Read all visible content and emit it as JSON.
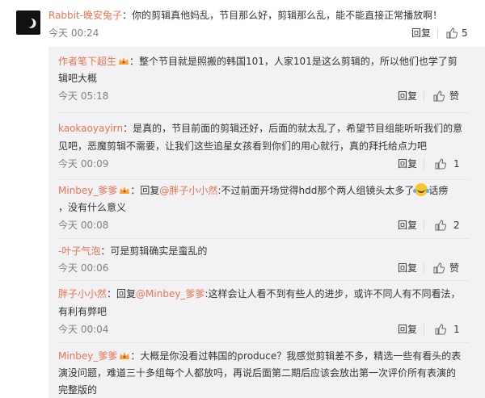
{
  "top": {
    "author": "Rabbit-晚安兔子",
    "sep": "：",
    "text": "你的剪辑真他妈乱，节目那么好，剪辑那么乱，能不能直接正常播放啊！",
    "time": "今天 00:24",
    "reply": "回复",
    "likes": "5"
  },
  "replies": [
    {
      "author": "作者笔下超生",
      "text1": "：整个节目就是照搬的韩国101，人家101是这么剪辑的，所以他们也学了剪",
      "text2": "辑吧大概",
      "time": "今天 05:18",
      "reply": "回复",
      "like": "赞"
    },
    {
      "author": "kaokaoyayirn",
      "text1": "：是真的，节目前面的剪辑还好，后面的就太乱了，希望节目组能听听我们的意",
      "text2": "见吧，恶魔剪辑不需要，让我们这些追星女孩看到你们的用心就行，真的拜托给点力吧",
      "time": "今天 00:09",
      "reply": "回复",
      "like": "1"
    },
    {
      "author": "Minbey_爹爹",
      "text_pre": "：回复",
      "mention": "@胖子小小然",
      "text_post": ":不过前面开场觉得hdd那个两人组镜头太多了",
      "text_end": "话痨",
      "text2": "，没有什么意义",
      "time": "今天 00:08",
      "reply": "回复",
      "like": "2"
    },
    {
      "author": "-叶子气泡",
      "text1": "：可是剪辑确实是蛮乱的",
      "time": "今天 00:06",
      "reply": "回复",
      "like": "赞"
    },
    {
      "author": "胖子小小然",
      "text_pre": "：回复",
      "mention": "@Minbey_爹爹",
      "text_post": ":这样会让人看不到有些人的进步，或许不同人有不同看法，",
      "text2": "有利有弊吧",
      "time": "今天 00:04",
      "reply": "回复",
      "like": "1"
    },
    {
      "author": "Minbey_爹爹",
      "text1": "：大概是你没看过韩国的produce？我感觉剪辑差不多，精选一些有看头的表",
      "text2": "演没问题，难道三十多组每个人都放吗，再说后面第二期后应该会放出第一次评价所有表演的",
      "text3": "完整版的"
    }
  ],
  "colors": {
    "name": "#eb7350",
    "badge": "#f2a531"
  }
}
